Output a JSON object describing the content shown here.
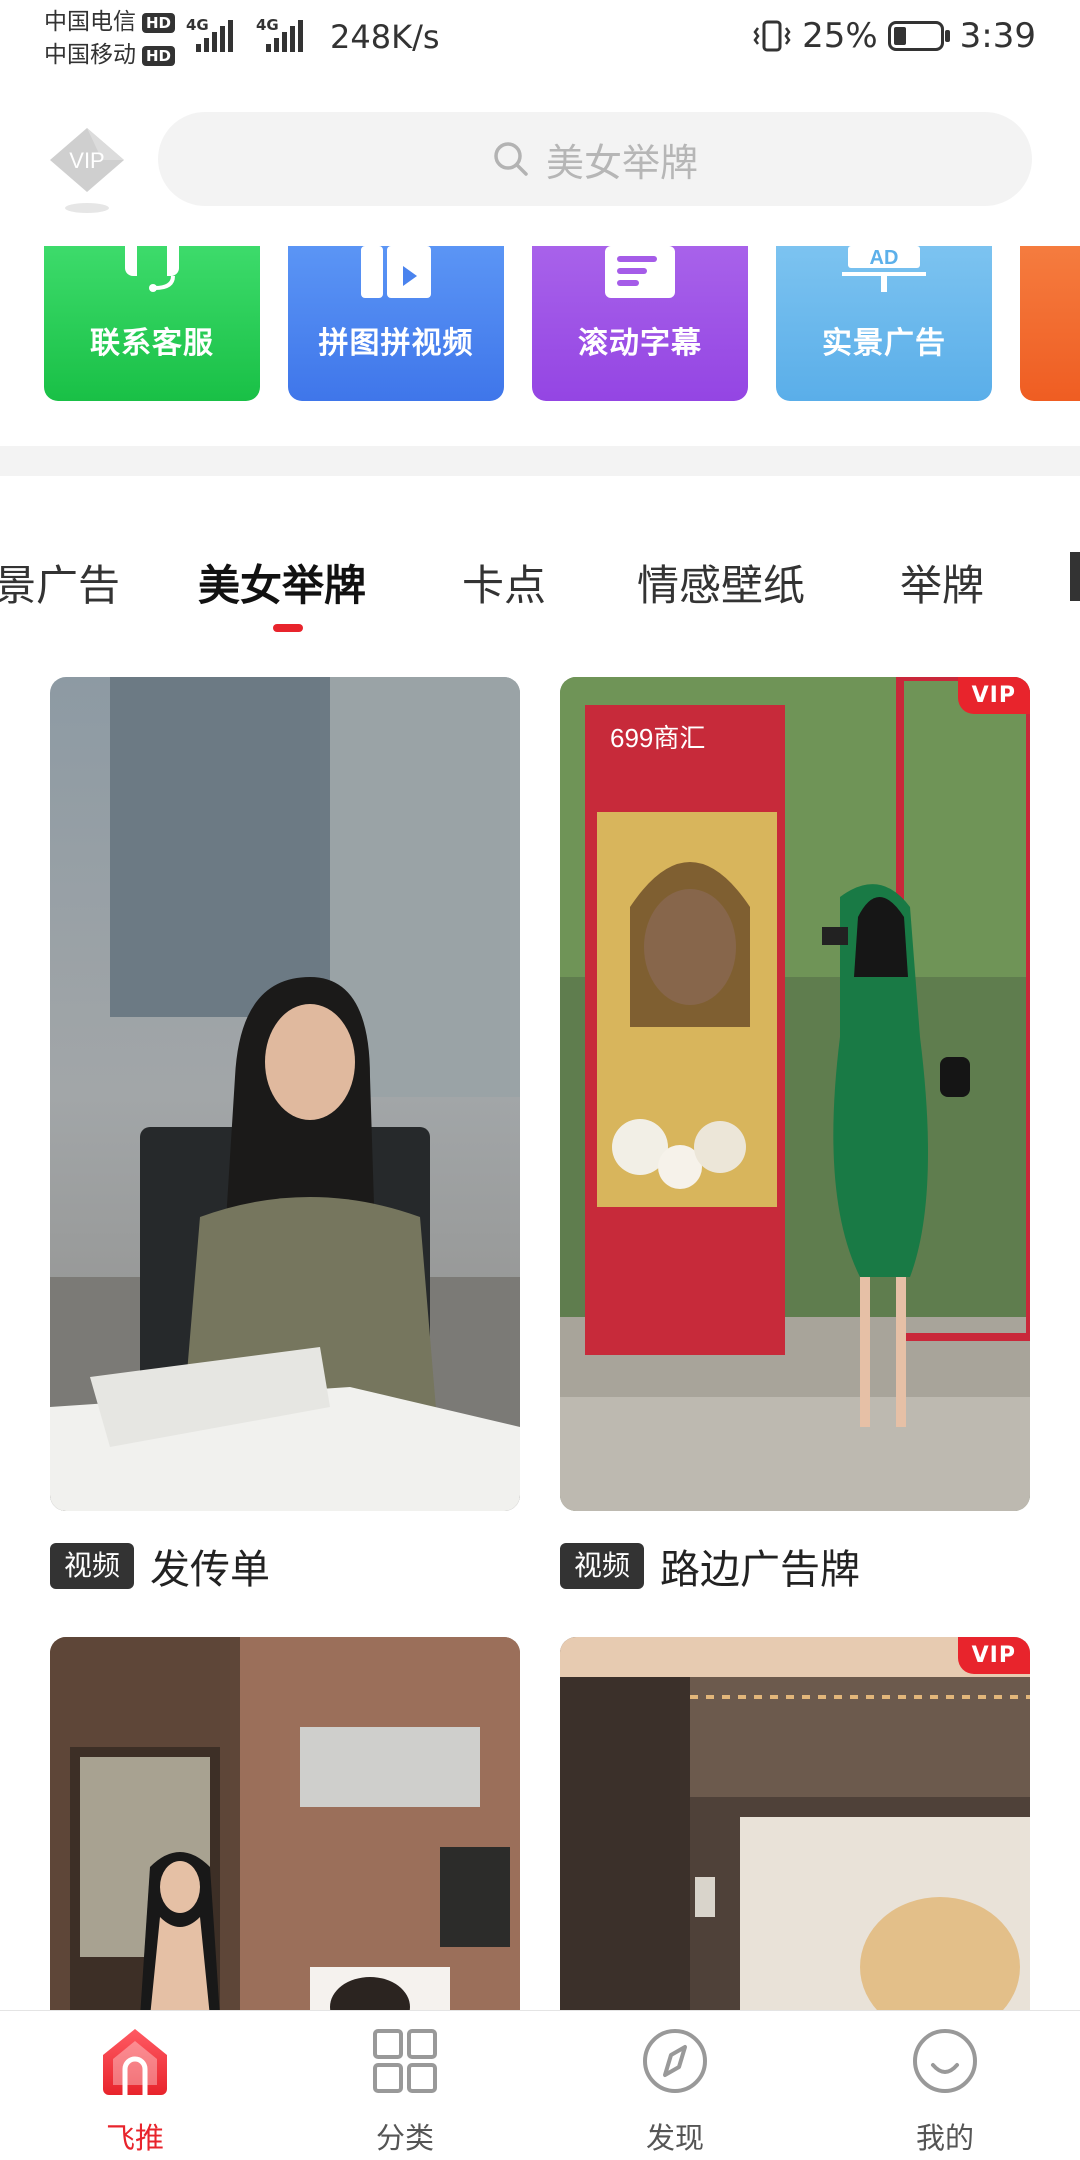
{
  "status_bar": {
    "carrier_1": "中国电信",
    "carrier_2": "中国移动",
    "hd": "HD",
    "network": "4G",
    "speed": "248K/s",
    "battery": "25%",
    "time": "3:39"
  },
  "header": {
    "vip_label": "VIP",
    "search_placeholder": "美女举牌"
  },
  "tools": [
    {
      "label": "联系客服",
      "color": "#22c84f"
    },
    {
      "label": "拼图拼视频",
      "color": "#4f86ef"
    },
    {
      "label": "滚动字幕",
      "color": "#9f53e6"
    },
    {
      "label": "实景广告",
      "color": "#5db4ec"
    },
    {
      "label": "",
      "color": "#f2692f"
    }
  ],
  "tool_icons": {
    "ad_text": "AD"
  },
  "tabs": [
    "景广告",
    "美女举牌",
    "卡点",
    "情感壁纸",
    "举牌"
  ],
  "active_tab": "美女举牌",
  "cards": [
    {
      "tag": "视频",
      "title": "发传单",
      "vip": false
    },
    {
      "tag": "视频",
      "title": "路边广告牌",
      "vip": true,
      "vip_label": "VIP",
      "sign_text": "699商汇"
    },
    {
      "vip": false
    },
    {
      "vip": true,
      "vip_label": "VIP"
    }
  ],
  "bottom_nav": [
    {
      "label": "飞推",
      "icon": "home-icon",
      "active": true
    },
    {
      "label": "分类",
      "icon": "grid-icon",
      "active": false
    },
    {
      "label": "发现",
      "icon": "compass-icon",
      "active": false
    },
    {
      "label": "我的",
      "icon": "smile-face-icon",
      "active": false
    }
  ],
  "colors": {
    "accent": "#e8242c",
    "search_bg": "#f3f3f3"
  }
}
